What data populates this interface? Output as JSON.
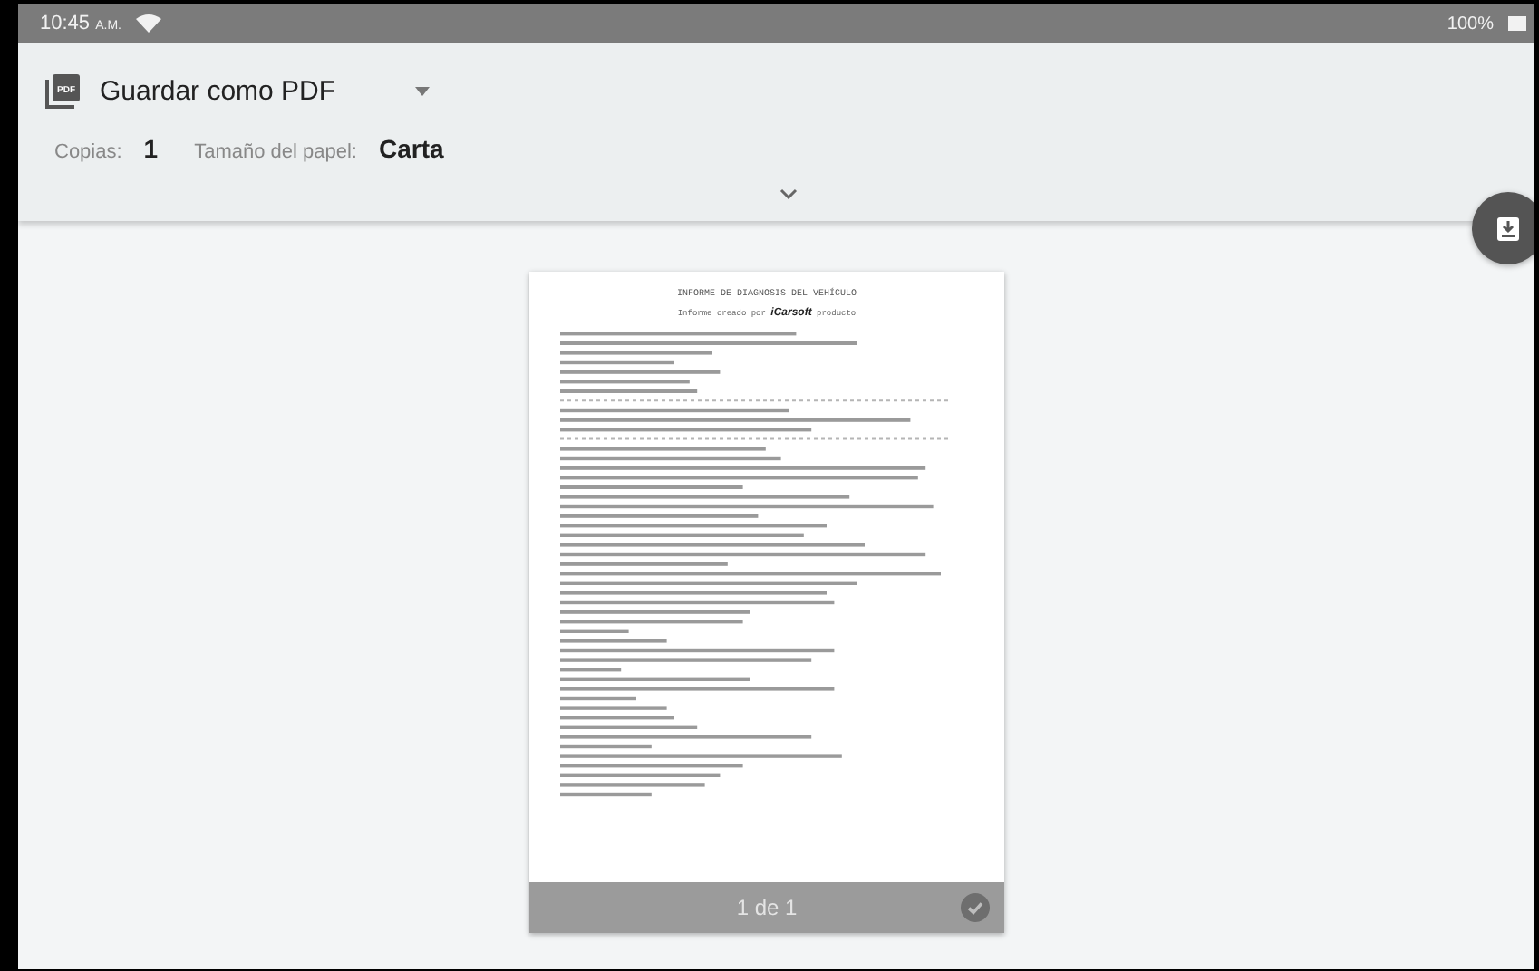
{
  "status_bar": {
    "time": "10:45",
    "ampm": "A.M.",
    "battery": "100%"
  },
  "printer": {
    "icon_text": "PDF",
    "name": "Guardar como PDF"
  },
  "options": [
    {
      "label": "Copias:",
      "value": "1"
    },
    {
      "label": "Tamaño del papel:",
      "value": "Carta"
    }
  ],
  "document": {
    "title": "INFORME DE DIAGNOSIS DEL VEHÍCULO",
    "subtitle": "Informe creado por **iCarsoft** producto"
  },
  "pager": {
    "text": "1 de 1",
    "selected": true
  }
}
